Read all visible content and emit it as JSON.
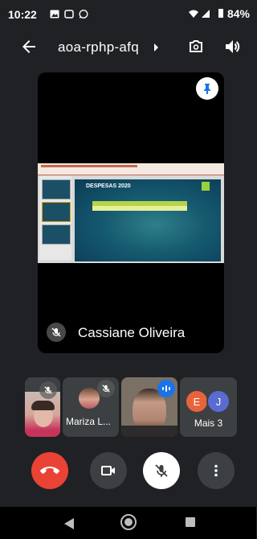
{
  "status_bar": {
    "time": "10:22",
    "battery": "84%"
  },
  "app_bar": {
    "meeting_code": "aoa-rphp-afq"
  },
  "main_tile": {
    "participant_name": "Cassiane Oliveira",
    "slide_title": "DESPESAS 2020"
  },
  "participants": [
    {
      "name": "",
      "muted": true
    },
    {
      "name": "Mariza L...",
      "muted": true
    },
    {
      "name": "",
      "speaking": true
    }
  ],
  "more_tile": {
    "initials": [
      "E",
      "J"
    ],
    "label": "Mais 3",
    "colors": [
      "#e8633b",
      "#5a6cd1"
    ]
  },
  "controls": {
    "end_call_color": "#ea4335"
  },
  "icons": [
    "arrow-back-icon",
    "switch-camera-icon",
    "volume-icon",
    "pin-icon",
    "mic-off-icon",
    "end-call-icon",
    "camera-icon",
    "more-vert-icon"
  ]
}
